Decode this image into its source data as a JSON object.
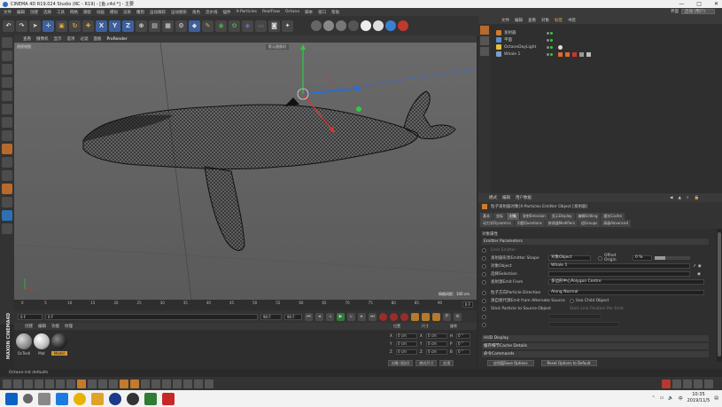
{
  "window": {
    "title": "CINEMA 4D R19.024 Studio (RC - R19) - [鱼.c4d *] - 主要",
    "controls": [
      "—",
      "□",
      "✕"
    ]
  },
  "menubar": {
    "items": [
      "文件",
      "编辑",
      "创建",
      "选择",
      "工具",
      "网格",
      "捕捉",
      "动画",
      "模拟",
      "渲染",
      "雕刻",
      "运动跟踪",
      "运动图形",
      "角色",
      "流水线",
      "插件",
      "X-Particles",
      "RealFlow",
      "Octane",
      "脚本",
      "窗口",
      "帮助"
    ],
    "layout_label": "界面",
    "layout_value": "启动 (用户)"
  },
  "viewport": {
    "menu": [
      "查看",
      "摄像机",
      "显示",
      "选项",
      "过滤",
      "面板",
      "ProRender"
    ],
    "label": "透视视图",
    "corner_label": "默认摄像机",
    "grid_distance": "网格间距：100 cm"
  },
  "timeline": {
    "ticks": [
      "0",
      "5",
      "10",
      "15",
      "20",
      "25",
      "30",
      "35",
      "40",
      "45",
      "50",
      "55",
      "60",
      "65",
      "70",
      "75",
      "80",
      "85",
      "90"
    ],
    "end_frame": "0 F"
  },
  "transport": {
    "start": "0 F",
    "current": "0 F",
    "end": "90 F",
    "max": "90 F"
  },
  "materials": {
    "menu": [
      "创建",
      "编辑",
      "功能",
      "纹理"
    ],
    "items": [
      {
        "label": "OcTexti",
        "color": "#9a9a9a"
      },
      {
        "label": "Mat",
        "color": "#c8c8c8"
      },
      {
        "label": "Model",
        "color": "#3a3a3a"
      }
    ],
    "brand": "MAXON CINEMA4D"
  },
  "coordinates": {
    "headers": [
      "位置",
      "尺寸",
      "旋转"
    ],
    "rows": [
      {
        "axis": "X",
        "pos": "0 cm",
        "size_label": "X",
        "size": "0 cm",
        "rot_label": "H",
        "rot": "0 °"
      },
      {
        "axis": "Y",
        "pos": "0 cm",
        "size_label": "Y",
        "size": "0 cm",
        "rot_label": "P",
        "rot": "0 °"
      },
      {
        "axis": "Z",
        "pos": "0 cm",
        "size_label": "Z",
        "size": "0 cm",
        "rot_label": "B",
        "rot": "0 °"
      }
    ],
    "mode_object": "对象 (相对)",
    "mode_size": "绝对尺寸",
    "apply": "应用"
  },
  "status": {
    "text": "Octane:init defaults"
  },
  "objects_manager": {
    "menu": [
      "文件",
      "编辑",
      "查看",
      "对象",
      "标签",
      "书签"
    ],
    "active_menu": "标签",
    "rows": [
      {
        "name": "发射器",
        "color": "#d07a2a"
      },
      {
        "name": "平面",
        "color": "#5a8fd0"
      },
      {
        "name": "OctaneDayLight",
        "color": "#e0c040"
      },
      {
        "name": "Whale 1",
        "color": "#7aa0c8"
      }
    ]
  },
  "attributes": {
    "menu": [
      "模式",
      "编辑",
      "用户数据"
    ],
    "title": "粒子发射器对象[X-Particles Emitter Object [发射器]",
    "tabs_row1": [
      "基本",
      "坐标",
      "对象",
      "发射Emission",
      "显示Display",
      "编辑Editing",
      "缓存Cache"
    ],
    "active_tab": "对象",
    "tabs_row2": [
      "动力学Dynamics",
      "问题Questions",
      "修改器Modifiers",
      "组Groups",
      "高级Advanced"
    ],
    "section_title": "对象属性",
    "emitter_params": "Emitter Parameters",
    "params": {
      "emitter_label": "Emit Emitter",
      "shape_label": "发射器形状Emitter Shape",
      "shape_value": "对象Object",
      "offset_label": "Offset Origin",
      "offset_value": "0 %",
      "object_label": "对象Object",
      "object_value": "Whale 1",
      "selection_label": "选择Selection",
      "emit_from_label": "发射源Emit From",
      "emit_from_value": "多边形中心Polygon Centre",
      "direction_label": "粒子方向Particle Direction",
      "direction_value": "Along Normal",
      "alt_source_label": "源自替代源Emit from Alternate Source",
      "use_child_label": "Use Child Object",
      "stick_label": "Stick Particle to Source Object",
      "stick_extra": "Stick Link Position Per Emit"
    },
    "sections": [
      "HUD Display",
      "缓存细节Cache Details",
      "命令Commands"
    ],
    "buttons": [
      "应用值Save Options",
      "Reset Options to Default"
    ]
  },
  "taskbar": {
    "time": "10:35",
    "date": "2019/11/5",
    "lang": "中"
  }
}
